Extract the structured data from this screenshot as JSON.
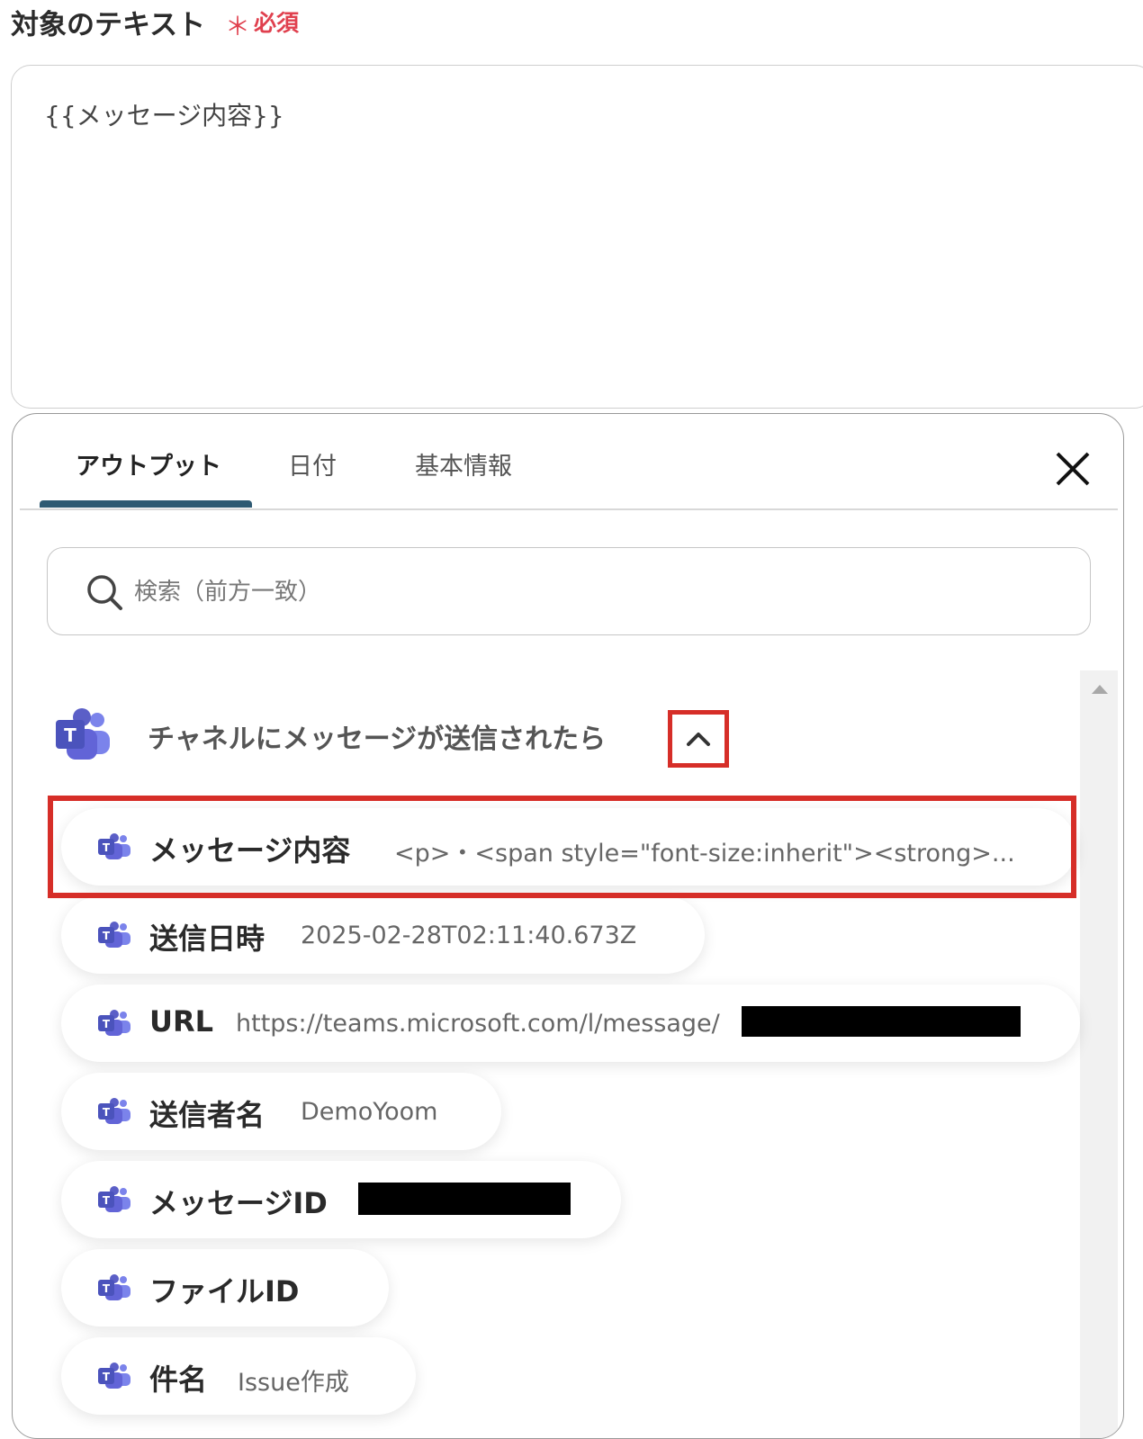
{
  "field": {
    "label": "対象のテキスト",
    "required_mark": "＊",
    "required_text": "必須",
    "value": "{{メッセージ内容}}"
  },
  "tabs": [
    {
      "label": "アウトプット",
      "active": true
    },
    {
      "label": "日付",
      "active": false
    },
    {
      "label": "基本情報",
      "active": false
    }
  ],
  "search": {
    "placeholder": "検索（前方一致）",
    "value": ""
  },
  "group": {
    "title": "チャネルにメッセージが送信されたら",
    "icon": "microsoft-teams-icon",
    "expanded": true
  },
  "outputs": [
    {
      "name": "メッセージ内容",
      "value": "<p>・<span style=\"font-size:inherit\"><strong>..."
    },
    {
      "name": "送信日時",
      "value": "2025-02-28T02:11:40.673Z"
    },
    {
      "name": "URL",
      "value": "https://teams.microsoft.com/l/message/"
    },
    {
      "name": "送信者名",
      "value": "DemoYoom"
    },
    {
      "name": "メッセージID",
      "value": ""
    },
    {
      "name": "ファイルID",
      "value": ""
    },
    {
      "name": "件名",
      "value": "Issue作成"
    }
  ],
  "colors": {
    "required": "#e0404e",
    "highlight": "#d62e28",
    "tab_underline": "#2e5a73",
    "teams_purple": "#5b5fc7"
  }
}
